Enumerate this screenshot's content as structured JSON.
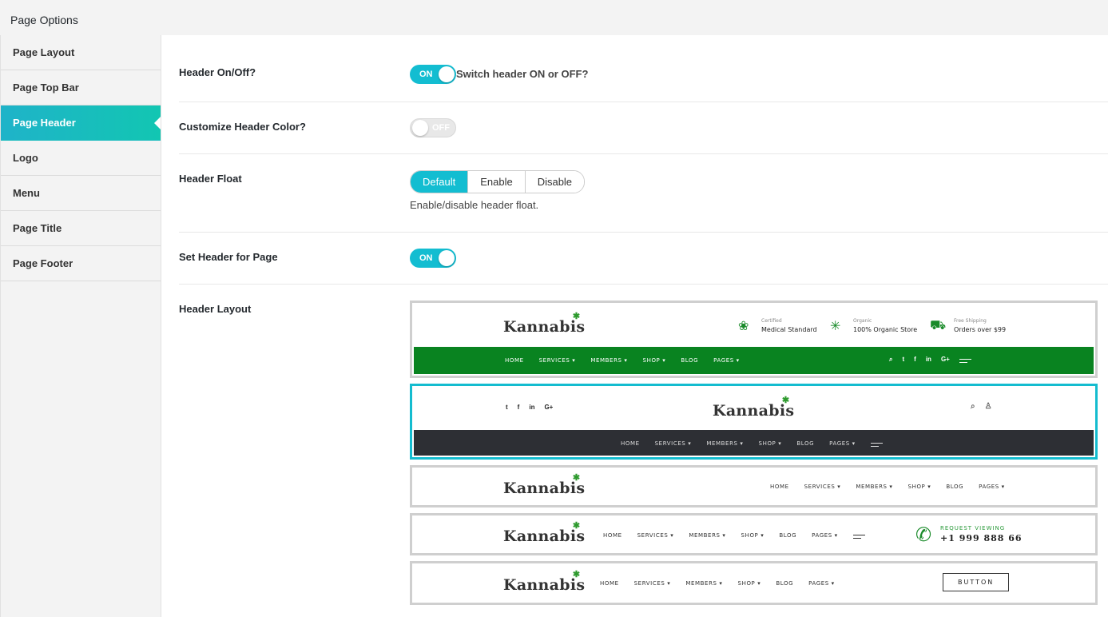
{
  "panel": {
    "title": "Page Options"
  },
  "sidebar": {
    "items": [
      {
        "label": "Page Layout"
      },
      {
        "label": "Page Top Bar"
      },
      {
        "label": "Page Header"
      },
      {
        "label": "Logo"
      },
      {
        "label": "Menu"
      },
      {
        "label": "Page Title"
      },
      {
        "label": "Page Footer"
      }
    ],
    "active": "Page Header"
  },
  "options": {
    "header_on_off": {
      "label": "Header On/Off?",
      "state": "ON",
      "help": "Switch header ON or OFF?"
    },
    "customize_color": {
      "label": "Customize Header Color?",
      "state": "OFF"
    },
    "header_float": {
      "label": "Header Float",
      "choices": [
        "Default",
        "Enable",
        "Disable"
      ],
      "selected": "Default",
      "help": "Enable/disable header float."
    },
    "set_header": {
      "label": "Set Header for Page",
      "state": "ON"
    },
    "header_layout": {
      "label": "Header Layout",
      "selected_index": 1
    }
  },
  "previews": {
    "brand": "Kannabis",
    "leaf": "✱",
    "nav": [
      "HOME",
      "SERVICES ▾",
      "MEMBERS ▾",
      "SHOP ▾",
      "BLOG",
      "PAGES ▾"
    ],
    "social": [
      "t",
      "f",
      "in",
      "G+"
    ],
    "search_icon": "⌕",
    "user_icon": "♙",
    "info": [
      {
        "small": "Certified",
        "big": "Medical Standard",
        "icon": "award-icon"
      },
      {
        "small": "Organic",
        "big": "100% Organic Store",
        "icon": "leaf-icon"
      },
      {
        "small": "Free Shipping",
        "big": "Orders over $99",
        "icon": "truck-icon"
      }
    ],
    "request": {
      "small": "REQUEST VIEWING",
      "big": "+1 999 888 66"
    },
    "button": "BUTTON",
    "colors": {
      "green": "#098320",
      "dark": "#2d2f34",
      "accent": "#13bdd1"
    }
  }
}
